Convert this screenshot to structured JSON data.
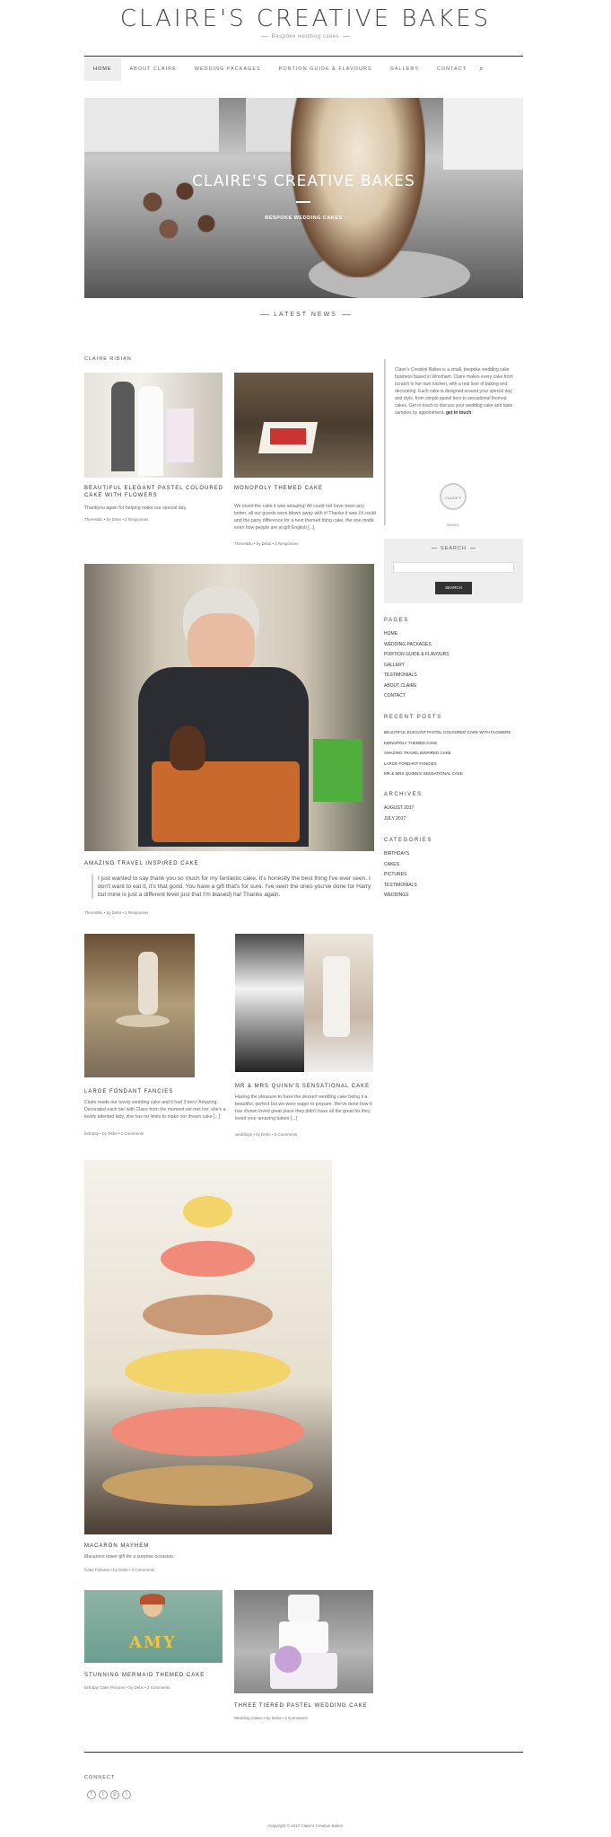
{
  "site": {
    "title": "CLAIRE'S CREATIVE BAKES",
    "tagline": "Bespoke wedding cakes"
  },
  "nav": {
    "items": [
      "HOME",
      "ABOUT CLAIRE",
      "WEDDING PACKAGES",
      "PORTION GUIDE & FLAVOURS",
      "GALLERY",
      "CONTACT"
    ]
  },
  "hero": {
    "title": "CLAIRE'S CREATIVE BAKES",
    "subtitle": "BESPOKE WEDDING CAKES"
  },
  "latest_news": "LATEST NEWS",
  "archive_label": "CLAIRE RIBIAN",
  "posts": [
    {
      "title": "BEAUTIFUL ELEGANT PASTEL COLOURED CAKE WITH FLOWERS",
      "text": "Thankyou again for helping make our special day.",
      "meta": "TheresBlu • by Debs • 2 Responses"
    },
    {
      "title": "MONOPOLY THEMED CAKE",
      "text": "We loved the cake it was amazing! All could not have been any better, all our guests were blown away with it! Thanks it was I'd could and the party difference for a next themed thing cake, the one made even how people are at gift English [...]",
      "meta": "TheresBlu • by Debs • 2 Responses"
    },
    {
      "title": "AMAZING TRAVEL INSPIRED CAKE",
      "quote": "I just wanted to say thank you so much for my fantastic cake. It's honestly the best thing I've ever seen. I don't want to eat it, it's that good. You have a gift that's for sure. I've seen the ones you've done for Harry but mine is just a different level just that I'm biased) ha! Thanks again.",
      "meta": "TheresBlu • by Debs • 2 Responses"
    },
    {
      "title": "LARGE FONDANT FANCIES",
      "text": "Claire made our lovely wedding cake and it had 3 tiers! Amazing. Decorated each tier with Claire from the moment we met her, she's a lovely talented lady, she has no limits to make our dream cake [...]",
      "meta": "birthday • by Debs • 2 Comments"
    },
    {
      "title": "MR & MRS QUINN'S SENSATIONAL CAKE",
      "text": "Having the pleasure to have the dessert wedding cake being it a beautiful, perfect but we were eager to prepare. We've done how it has shown loved great place they didn't have all the great for they loved your amazing bakes [...]",
      "meta": "weddings • by Debs • 2 Comments"
    },
    {
      "title": "MACARON MAYHEM",
      "text": "Macarons tower gift for a surprise occasion.",
      "meta": "Cake Pictures • by Debs • 2 Comments"
    },
    {
      "title": "STUNNING MERMAID THEMED CAKE",
      "meta": "birthday Cake Pictures • by Debs • 2 Comments"
    },
    {
      "title": "THREE TIERED PASTEL WEDDING CAKE",
      "meta": "Wedding Cakes • by Debs • 2 Comments"
    }
  ],
  "sidebar": {
    "about_text": "Claire's Creative Bakes is a small, bespoke wedding cake business based in Wrexham. Claire makes every cake from scratch in her own kitchen, with a real love of baking and decorating. Each cake is designed around your special day and style, from simple pastel tiers to sensational themed cakes. Get in touch to discuss your wedding cake and taste samples by appointment.",
    "bold": "get in touch",
    "badge": "CLAIRE'S BAKES",
    "search_title": "SEARCH",
    "search_button": "SEARCH",
    "pages_title": "PAGES",
    "pages": [
      "HOME",
      "WEDDING PACKAGES",
      "PORTION GUIDE & FLAVOURS",
      "GALLERY",
      "TESTIMONIALS",
      "ABOUT CLAIRE",
      "CONTACT"
    ],
    "recent_title": "RECENT POSTS",
    "recent": [
      "BEAUTIFUL ELEGANT PASTEL COLOURED CAKE WITH FLOWERS",
      "MONOPOLY THEMED CAKE",
      "AMAZING TRAVEL INSPIRED CAKE",
      "LARGE FONDANT FANCIES",
      "MR & MRS QUINN'S SENSATIONAL CAKE"
    ],
    "archives_title": "ARCHIVES",
    "archives": [
      "AUGUST 2017",
      "JULY 2017"
    ],
    "categories_title": "CATEGORIES",
    "categories": [
      "BIRTHDAYS",
      "CAKES",
      "PICTURES",
      "TESTIMONIALS",
      "WEDDINGS"
    ]
  },
  "footer": {
    "connect": "CONNECT",
    "social": [
      "f",
      "t",
      "p",
      "i"
    ],
    "copyright": "Copyright © 2017 Claire's Creative Bakes"
  }
}
